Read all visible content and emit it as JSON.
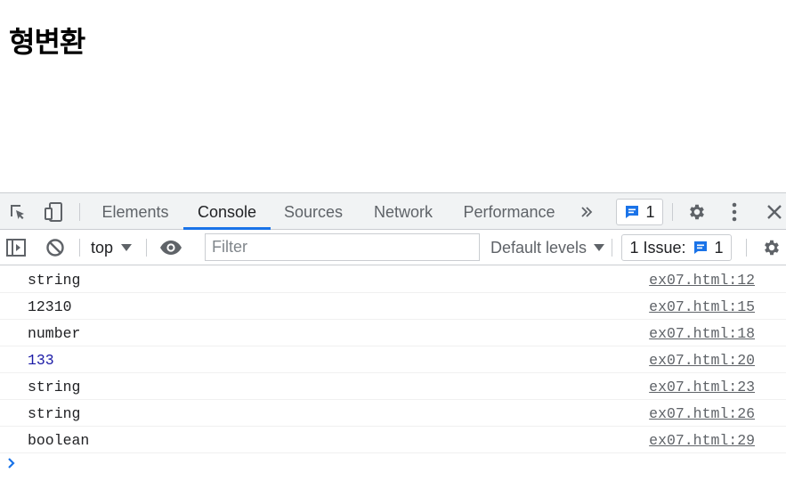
{
  "page": {
    "title": "형변환"
  },
  "devtools": {
    "tabs": [
      "Elements",
      "Console",
      "Sources",
      "Network",
      "Performance"
    ],
    "active_tab": "Console",
    "more_tabs_icon": "chevron-double-right-icon",
    "messages_badge": {
      "icon": "chat-icon",
      "count": "1"
    },
    "settings_icon": "gear-icon",
    "menu_icon": "kebab-icon",
    "close_icon": "close-icon"
  },
  "console_toolbar": {
    "context": "top",
    "filter_placeholder": "Filter",
    "levels": "Default levels",
    "issues": {
      "label": "1 Issue:",
      "count": "1"
    }
  },
  "console": {
    "logs": [
      {
        "message": "string",
        "source": "ex07.html:12",
        "kind": "text"
      },
      {
        "message": "12310",
        "source": "ex07.html:15",
        "kind": "text"
      },
      {
        "message": "number",
        "source": "ex07.html:18",
        "kind": "text"
      },
      {
        "message": "133",
        "source": "ex07.html:20",
        "kind": "num"
      },
      {
        "message": "string",
        "source": "ex07.html:23",
        "kind": "text"
      },
      {
        "message": "string",
        "source": "ex07.html:26",
        "kind": "text"
      },
      {
        "message": "boolean",
        "source": "ex07.html:29",
        "kind": "text"
      }
    ]
  },
  "colors": {
    "accent": "#1a73e8",
    "number": "#1a1aa6",
    "toolbar_bg": "#f1f3f4"
  }
}
